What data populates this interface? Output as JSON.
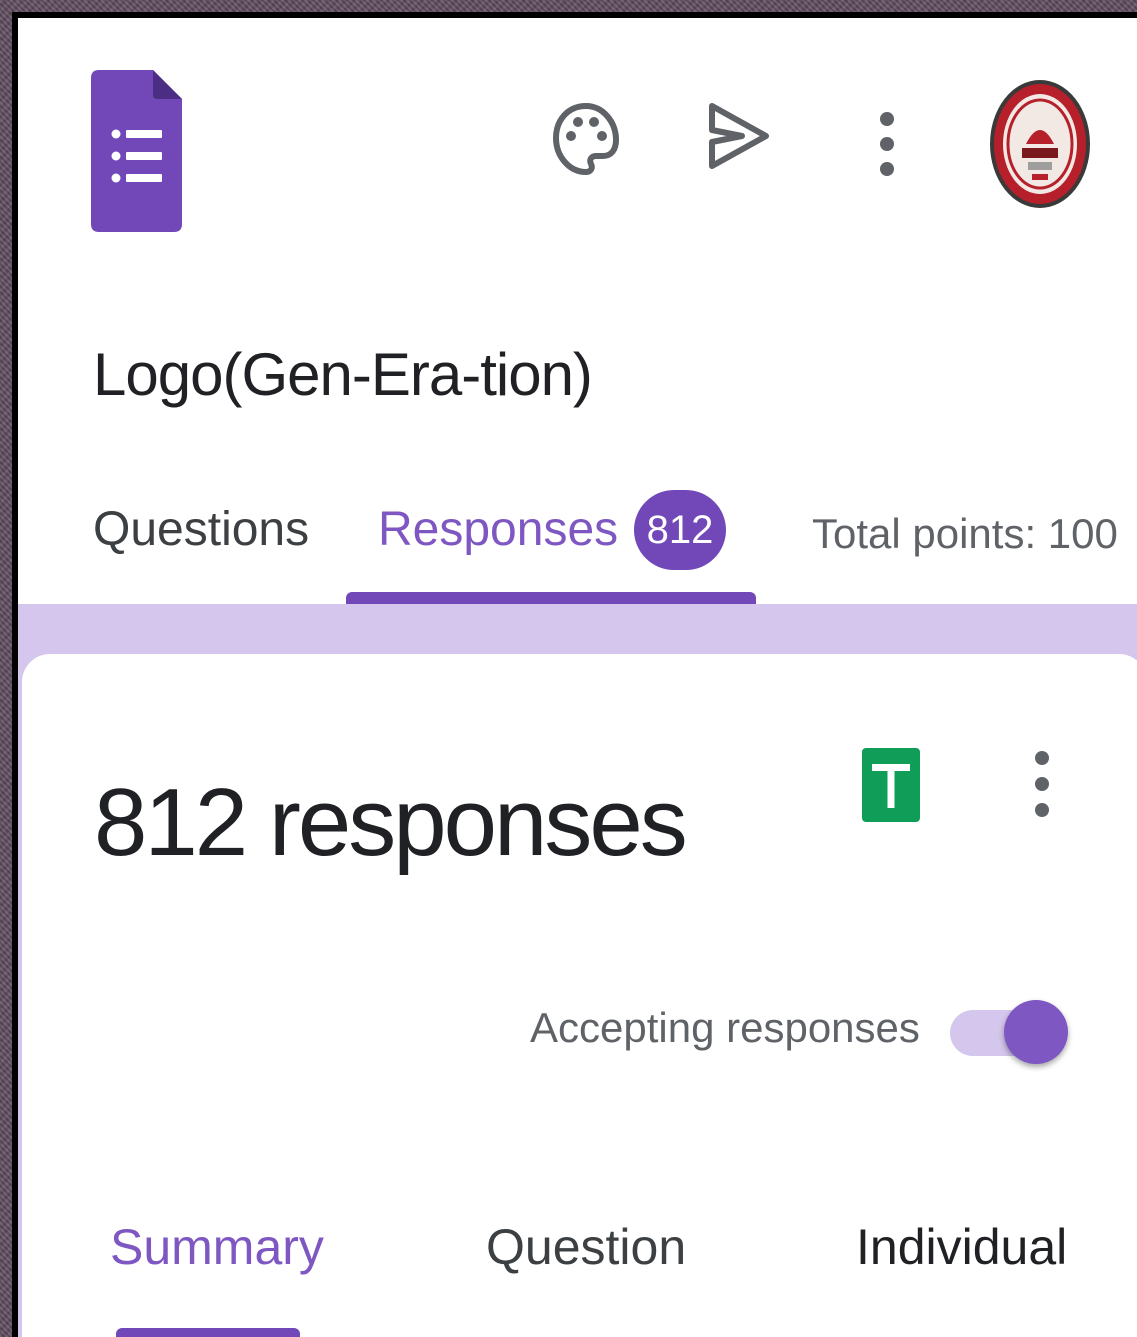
{
  "header": {
    "app_icon": "google-forms-icon",
    "icons": [
      "palette-icon",
      "send-icon",
      "more-vert-icon"
    ],
    "avatar": "institution-seal-avatar"
  },
  "form": {
    "title": "Logo(Gen-Era-tion)"
  },
  "tabs": {
    "questions": "Questions",
    "responses": "Responses",
    "responses_badge": "812",
    "total_points": "Total points: 100",
    "active": "Responses"
  },
  "responses_card": {
    "count_text": "812 responses",
    "accepting_label": "Accepting responses",
    "accepting_on": true
  },
  "sub_tabs": {
    "summary": "Summary",
    "question": "Question",
    "individual": "Individual",
    "active": "Summary"
  },
  "colors": {
    "accent": "#7248b9",
    "accent_light": "#d4c6ec",
    "sheets_green": "#0f9d58"
  }
}
